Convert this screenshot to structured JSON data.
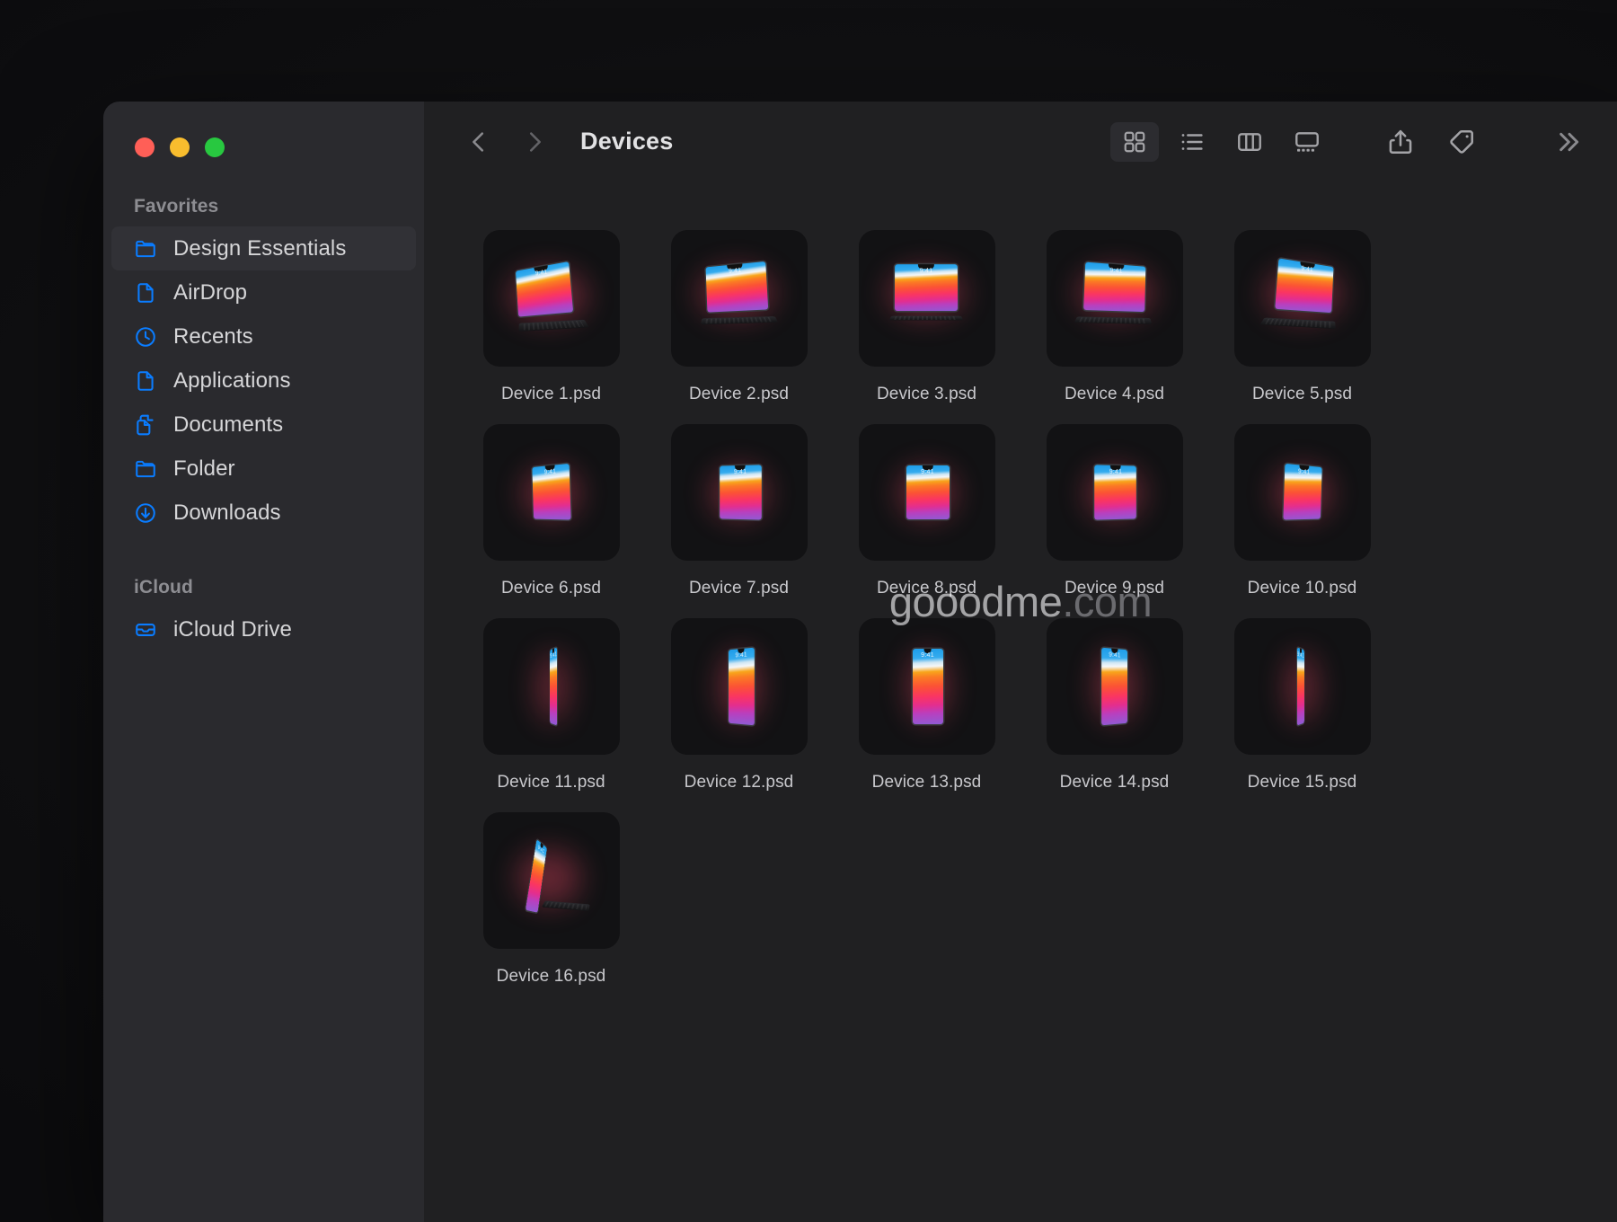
{
  "window": {
    "title": "Devices",
    "traffic_lights": [
      {
        "name": "close",
        "color": "#ff5f57"
      },
      {
        "name": "minimize",
        "color": "#f9bd2e"
      },
      {
        "name": "zoom",
        "color": "#28c840"
      }
    ]
  },
  "sidebar": {
    "sections": [
      {
        "title": "Favorites",
        "items": [
          {
            "label": "Design Essentials",
            "icon": "folder-icon",
            "selected": true
          },
          {
            "label": "AirDrop",
            "icon": "document-icon",
            "selected": false
          },
          {
            "label": "Recents",
            "icon": "clock-icon",
            "selected": false
          },
          {
            "label": "Applications",
            "icon": "document-icon",
            "selected": false
          },
          {
            "label": "Documents",
            "icon": "documents-icon",
            "selected": false
          },
          {
            "label": "Folder",
            "icon": "folder-icon",
            "selected": false
          },
          {
            "label": "Downloads",
            "icon": "download-icon",
            "selected": false
          }
        ]
      },
      {
        "title": "iCloud",
        "items": [
          {
            "label": "iCloud Drive",
            "icon": "icloud-drive-icon",
            "selected": false
          }
        ]
      }
    ],
    "accent_color": "#0a7cff",
    "background_color": "#2a2a2e"
  },
  "toolbar": {
    "back_label": "Back",
    "forward_label": "Forward",
    "path_title": "Devices",
    "view_modes": [
      {
        "name": "icon-view",
        "label": "as Icons",
        "icon": "grid-icon",
        "active": true
      },
      {
        "name": "list-view",
        "label": "as List",
        "icon": "list-icon",
        "active": false
      },
      {
        "name": "column-view",
        "label": "as Columns",
        "icon": "columns-icon",
        "active": false
      },
      {
        "name": "gallery-view",
        "label": "as Gallery",
        "icon": "gallery-icon",
        "active": false
      }
    ],
    "actions": [
      {
        "name": "share",
        "label": "Share",
        "icon": "share-icon"
      },
      {
        "name": "tags",
        "label": "Tags",
        "icon": "tag-icon"
      }
    ],
    "more_label": "More",
    "more_icon": "double-chevron-right-icon"
  },
  "files": [
    {
      "name": "Device 1.psd",
      "art": "tablet-kickstand-left"
    },
    {
      "name": "Device 2.psd",
      "art": "laptop-open-left"
    },
    {
      "name": "Device 3.psd",
      "art": "laptop-front"
    },
    {
      "name": "Device 4.psd",
      "art": "laptop-open-right"
    },
    {
      "name": "Device 5.psd",
      "art": "laptop-angled-right"
    },
    {
      "name": "Device 6.psd",
      "art": "tablet-landscape-left"
    },
    {
      "name": "Device 7.psd",
      "art": "tablet-landscape-front"
    },
    {
      "name": "Device 8.psd",
      "art": "tablet-landscape-flat"
    },
    {
      "name": "Device 9.psd",
      "art": "tablet-landscape-right"
    },
    {
      "name": "Device 10.psd",
      "art": "tablet-landscape-tilt"
    },
    {
      "name": "Device 11.psd",
      "art": "phone-edge-left"
    },
    {
      "name": "Device 12.psd",
      "art": "phone-portrait-left"
    },
    {
      "name": "Device 13.psd",
      "art": "phone-portrait-front"
    },
    {
      "name": "Device 14.psd",
      "art": "phone-portrait-right"
    },
    {
      "name": "Device 15.psd",
      "art": "phone-edge-right"
    },
    {
      "name": "Device 16.psd",
      "art": "tablet-keyboard-side"
    }
  ],
  "device_screen": {
    "status_time": "9:41",
    "wallpaper": "big-sur-gradient",
    "wallpaper_colors": [
      "#1d9ce9",
      "#f5f7f9",
      "#f8a51b",
      "#fb5235",
      "#fa3562",
      "#8f5bd4"
    ]
  },
  "watermark": {
    "main": "gooodme",
    "tld": ".com"
  },
  "theme": {
    "page_background": "#111113",
    "content_background": "#202022",
    "thumb_background": "#121214",
    "text_primary": "#d6d6d8",
    "text_secondary": "#8d8d92"
  }
}
